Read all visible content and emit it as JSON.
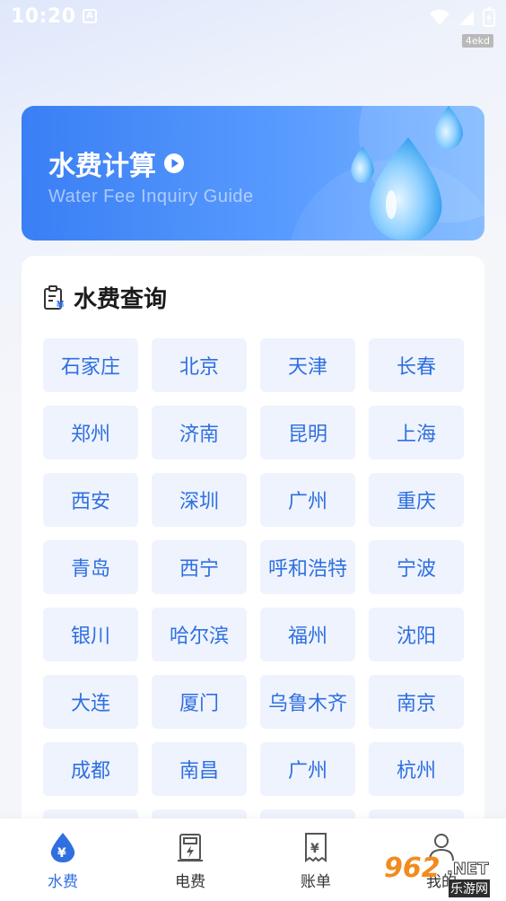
{
  "status_bar": {
    "time": "10:20",
    "badge": "A",
    "watermark": "4ekd"
  },
  "banner": {
    "title": "水费计算",
    "subtitle": "Water Fee Inquiry Guide",
    "play_icon": "play-circle-icon",
    "art": "water-drops"
  },
  "card": {
    "title": "水费查询",
    "icon": "clipboard-yuan-icon",
    "cities": [
      "石家庄",
      "北京",
      "天津",
      "长春",
      "郑州",
      "济南",
      "昆明",
      "上海",
      "西安",
      "深圳",
      "广州",
      "重庆",
      "青岛",
      "西宁",
      "呼和浩特",
      "宁波",
      "银川",
      "哈尔滨",
      "福州",
      "沈阳",
      "大连",
      "厦门",
      "乌鲁木齐",
      "南京",
      "成都",
      "南昌",
      "广州",
      "杭州"
    ]
  },
  "bottom_nav": {
    "items": [
      {
        "label": "水费",
        "icon": "water-drop-yuan-icon",
        "active": true
      },
      {
        "label": "电费",
        "icon": "meter-icon",
        "active": false
      },
      {
        "label": "账单",
        "icon": "bill-icon",
        "active": false
      },
      {
        "label": "我的",
        "icon": "user-icon",
        "active": false
      }
    ]
  },
  "overlay_logo": {
    "num": "962",
    "net": ".NET",
    "cn": "乐游网"
  },
  "colors": {
    "primary": "#2f6fe0",
    "tile_bg": "#eef3fd",
    "banner_start": "#3a7ff4"
  }
}
